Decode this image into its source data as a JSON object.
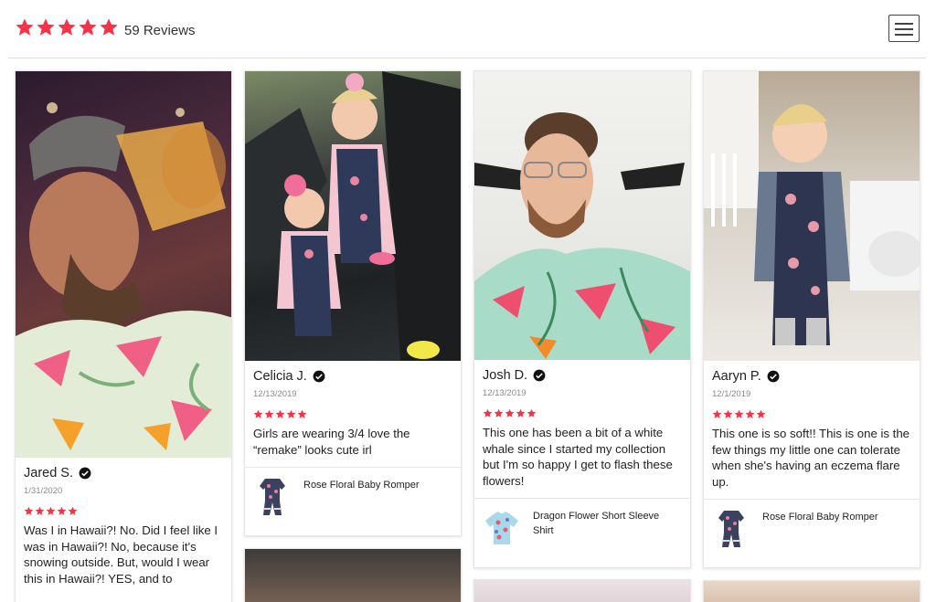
{
  "header": {
    "review_count": "59 Reviews",
    "star_color": "#f5344a"
  },
  "reviews": [
    {
      "name": "Jared S.",
      "date": "1/31/2020",
      "text": "Was I in Hawaii?! No. Did I feel like I was in Hawaii?! No, because it's snowing outside. But, would I wear this in Hawaii?! YES, and to"
    },
    {
      "name": "Celicia J.",
      "date": "12/13/2019",
      "text": "Girls are wearing 3/4 love the “remake” looks cute irl",
      "product": "Rose Floral Baby Romper"
    },
    {
      "name": "Josh D.",
      "date": "12/13/2019",
      "text": "This one has been a bit of a white whale since I started my collection but I'm so happy I get to flash these flowers!",
      "product": "Dragon Flower Short Sleeve Shirt"
    },
    {
      "name": "Aaryn P.",
      "date": "12/1/2019",
      "text": "This one is so soft!! This is one is the few things my little one can tolerate when she's having an eczema flare up.",
      "product": "Rose Floral Baby Romper"
    }
  ]
}
